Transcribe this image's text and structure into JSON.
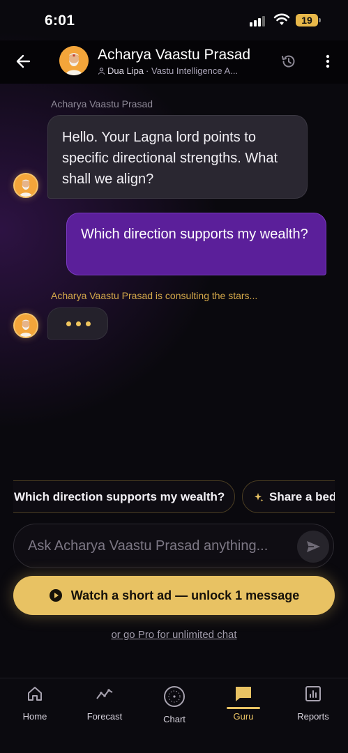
{
  "status_bar": {
    "time": "6:01",
    "battery": "19"
  },
  "header": {
    "title": "Acharya Vaastu Prasad",
    "subtitle_user": "Dua Lipa",
    "subtitle_rest": " · Vastu Intelligence A..."
  },
  "messages": {
    "ai_sender": "Acharya Vaastu Prasad",
    "ai_text": "Hello. Your Lagna lord points to specific directional strengths. What shall we align?",
    "user_text": "Which direction supports my wealth?",
    "typing_status": "Acharya Vaastu Prasad is consulting the stars..."
  },
  "suggestions": [
    {
      "label": "Which direction supports my wealth?"
    },
    {
      "label": "Share a bed"
    }
  ],
  "composer": {
    "placeholder": "Ask Acharya Vaastu Prasad anything..."
  },
  "watch_ad": {
    "label": "Watch a short ad — unlock 1 message"
  },
  "pro_link": {
    "label": "or go Pro for unlimited chat"
  },
  "bottom_nav": {
    "items": [
      {
        "label": "Home",
        "icon": "home-icon"
      },
      {
        "label": "Forecast",
        "icon": "trend-icon"
      },
      {
        "label": "Chart",
        "icon": "chart-wheel-icon"
      },
      {
        "label": "Guru",
        "icon": "chat-bubble-icon",
        "active": true
      },
      {
        "label": "Reports",
        "icon": "bar-chart-icon"
      }
    ]
  },
  "colors": {
    "accent_gold": "#e8c263",
    "user_bubble": "#5b1f9a",
    "ai_bubble": "#2a2731"
  }
}
